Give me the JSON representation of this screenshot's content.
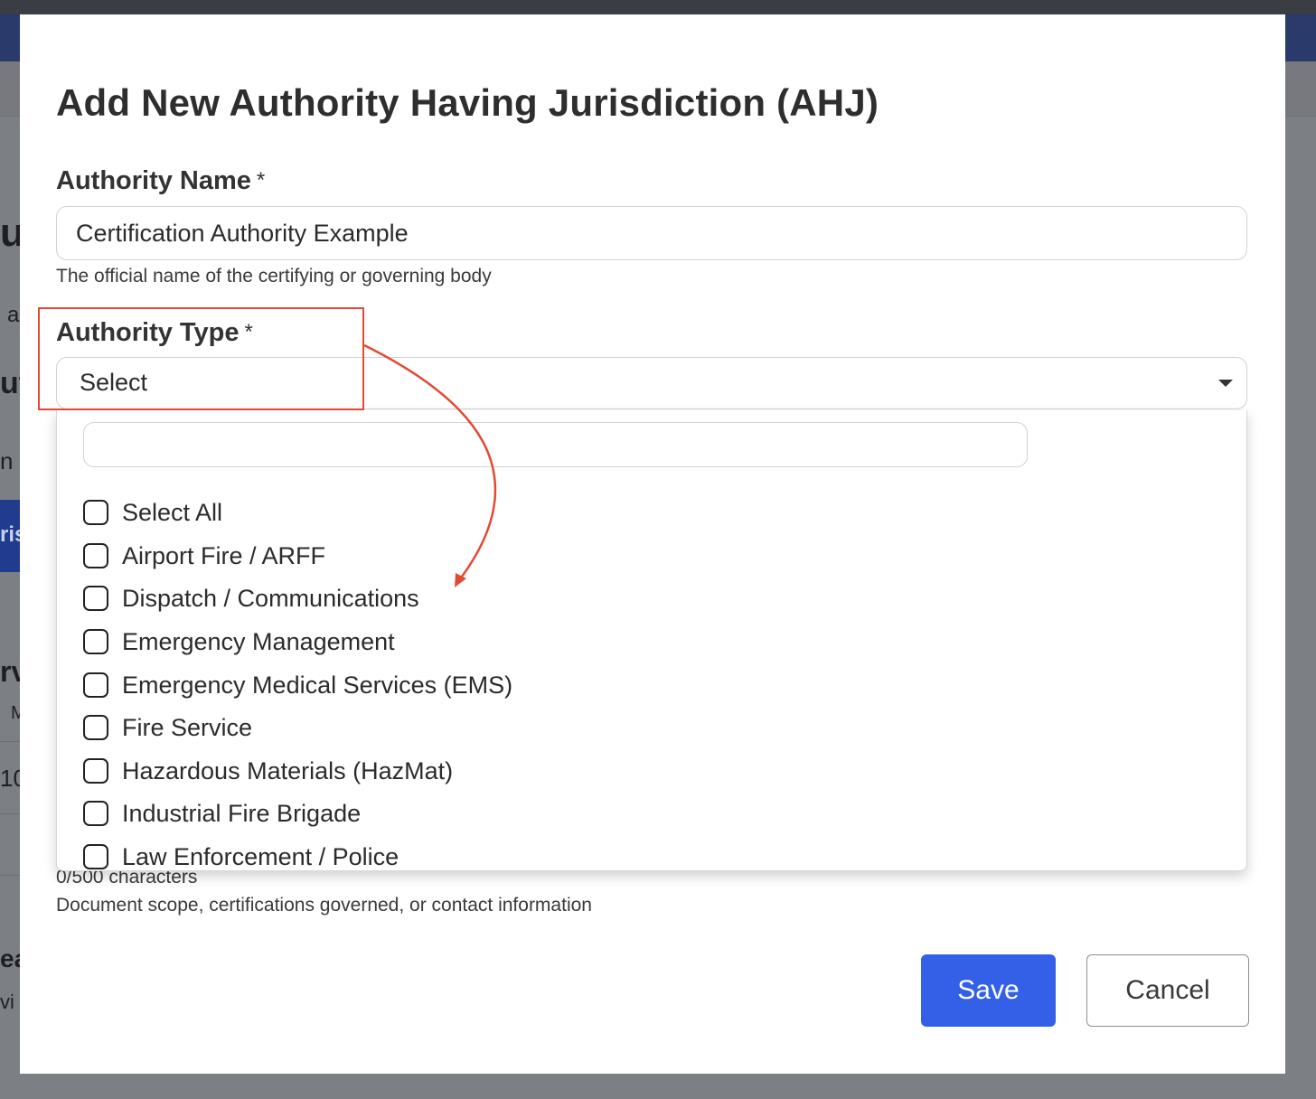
{
  "modal": {
    "title": "Add New Authority Having Jurisdiction (AHJ)",
    "authority_name": {
      "label": "Authority Name",
      "required_mark": "*",
      "value": "Certification Authority Example",
      "help": "The official name of the certifying or governing body"
    },
    "authority_type": {
      "label": "Authority Type",
      "required_mark": "*",
      "selected": "Select",
      "search_value": "",
      "options": [
        "Select All",
        "Airport Fire / ARFF",
        "Dispatch / Communications",
        "Emergency Management",
        "Emergency Medical Services (EMS)",
        "Fire Service",
        "Hazardous Materials (HazMat)",
        "Industrial Fire Brigade",
        "Law Enforcement / Police"
      ]
    },
    "notes": {
      "char_count": "0/500 characters",
      "help": "Document scope, certifications governed, or contact information"
    },
    "buttons": {
      "save": "Save",
      "cancel": "Cancel"
    }
  },
  "background": {
    "fragments": [
      "u",
      "a",
      "ut",
      "n y",
      "ris",
      "rv",
      "M",
      "10",
      "ea",
      "vi"
    ]
  },
  "colors": {
    "primary": "#3360e6",
    "annotation": "#e24a33",
    "overlay": "#7c7f84"
  }
}
